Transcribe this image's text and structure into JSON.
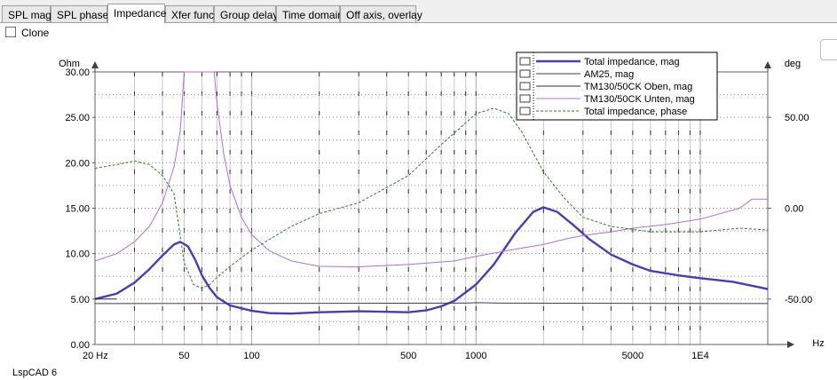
{
  "tabs": [
    "SPL mag",
    "SPL phase",
    "Impedance",
    "Xfer func",
    "Group delay",
    "Time domain",
    "Off axis, overlay"
  ],
  "active_tab": "Impedance",
  "clone_label": "Clone",
  "app_name": "LspCAD 6",
  "chart_data": {
    "type": "line",
    "xscale": "log",
    "xlim": [
      20,
      20000
    ],
    "ylim": [
      0,
      30
    ],
    "y2lim": [
      -75,
      75
    ],
    "ylabel": "Ohm",
    "y2label": "deg",
    "xlabel": "Hz",
    "x_ticks": [
      "20 Hz",
      "50",
      "100",
      "500",
      "1000",
      "5000",
      "1E4"
    ],
    "y_ticks": [
      "30.00",
      "25.00",
      "20.00",
      "15.00",
      "10.00",
      "5.00",
      "0.00"
    ],
    "y2_ticks": [
      "50.00",
      "0.00",
      "-50.00"
    ],
    "legend_position": "top-right",
    "series": [
      {
        "name": "Total impedance, mag",
        "color": "#4b3ea8",
        "axis": "left",
        "style": "thick",
        "points": [
          [
            20,
            5.0
          ],
          [
            25,
            5.6
          ],
          [
            30,
            6.8
          ],
          [
            35,
            8.3
          ],
          [
            40,
            9.8
          ],
          [
            45,
            11.0
          ],
          [
            48,
            11.3
          ],
          [
            52,
            10.8
          ],
          [
            56,
            9.3
          ],
          [
            60,
            7.6
          ],
          [
            65,
            6.2
          ],
          [
            70,
            5.2
          ],
          [
            80,
            4.3
          ],
          [
            100,
            3.7
          ],
          [
            120,
            3.45
          ],
          [
            150,
            3.4
          ],
          [
            200,
            3.55
          ],
          [
            300,
            3.65
          ],
          [
            400,
            3.6
          ],
          [
            500,
            3.55
          ],
          [
            600,
            3.75
          ],
          [
            700,
            4.2
          ],
          [
            800,
            4.8
          ],
          [
            1000,
            6.6
          ],
          [
            1200,
            8.8
          ],
          [
            1500,
            12.3
          ],
          [
            1800,
            14.6
          ],
          [
            2000,
            15.1
          ],
          [
            2300,
            14.6
          ],
          [
            2700,
            13.2
          ],
          [
            3200,
            11.6
          ],
          [
            4000,
            9.9
          ],
          [
            5000,
            8.8
          ],
          [
            6000,
            8.1
          ],
          [
            8000,
            7.6
          ],
          [
            10000,
            7.3
          ],
          [
            14000,
            6.9
          ],
          [
            20000,
            6.1
          ]
        ]
      },
      {
        "name": "AM25, mag",
        "color": "#3a3a6a",
        "axis": "left",
        "style": "thin",
        "points": [
          [
            20,
            4.5
          ],
          [
            900,
            4.55
          ],
          [
            1000,
            4.6
          ],
          [
            1300,
            4.55
          ],
          [
            20000,
            4.5
          ]
        ]
      },
      {
        "name": "TM130/50CK Oben, mag",
        "color": "#2a2a4a",
        "axis": "left",
        "style": "thin",
        "points": [
          [
            20,
            5.0
          ],
          [
            25,
            5.0
          ]
        ]
      },
      {
        "name": "TM130/50CK Unten, mag",
        "color": "#b070d0",
        "axis": "left",
        "style": "thin",
        "points": [
          [
            20,
            9.2
          ],
          [
            25,
            10.0
          ],
          [
            30,
            11.3
          ],
          [
            35,
            13.0
          ],
          [
            40,
            15.6
          ],
          [
            45,
            19.5
          ],
          [
            48,
            23.5
          ],
          [
            50,
            30.0
          ],
          [
            68,
            30.0
          ],
          [
            70,
            26.5
          ],
          [
            75,
            21.0
          ],
          [
            80,
            17.5
          ],
          [
            90,
            14.0
          ],
          [
            100,
            12.1
          ],
          [
            120,
            10.3
          ],
          [
            150,
            9.2
          ],
          [
            200,
            8.6
          ],
          [
            300,
            8.55
          ],
          [
            500,
            8.8
          ],
          [
            800,
            9.2
          ],
          [
            1000,
            9.7
          ],
          [
            1500,
            10.5
          ],
          [
            2000,
            11.0
          ],
          [
            2500,
            11.6
          ],
          [
            3000,
            12.0
          ],
          [
            4000,
            12.4
          ],
          [
            5000,
            12.8
          ],
          [
            7000,
            13.2
          ],
          [
            10000,
            13.8
          ],
          [
            15000,
            15.0
          ],
          [
            17000,
            16.0
          ],
          [
            20000,
            16.0
          ]
        ]
      },
      {
        "name": "Total impedance, phase",
        "color": "#2e7d32",
        "axis": "right",
        "style": "dashed",
        "points": [
          [
            20,
            22
          ],
          [
            25,
            24
          ],
          [
            30,
            26
          ],
          [
            35,
            24
          ],
          [
            40,
            18
          ],
          [
            45,
            8
          ],
          [
            50,
            -30
          ],
          [
            55,
            -42
          ],
          [
            60,
            -44
          ],
          [
            65,
            -42
          ],
          [
            70,
            -38
          ],
          [
            80,
            -32
          ],
          [
            100,
            -23
          ],
          [
            150,
            -10
          ],
          [
            200,
            -3
          ],
          [
            300,
            3
          ],
          [
            500,
            18
          ],
          [
            700,
            35
          ],
          [
            1000,
            52
          ],
          [
            1200,
            55
          ],
          [
            1400,
            52
          ],
          [
            1600,
            42
          ],
          [
            2000,
            20
          ],
          [
            2500,
            5
          ],
          [
            3000,
            -5
          ],
          [
            4000,
            -10
          ],
          [
            6000,
            -13
          ],
          [
            10000,
            -13
          ],
          [
            15000,
            -11
          ],
          [
            20000,
            -12
          ]
        ]
      }
    ]
  }
}
